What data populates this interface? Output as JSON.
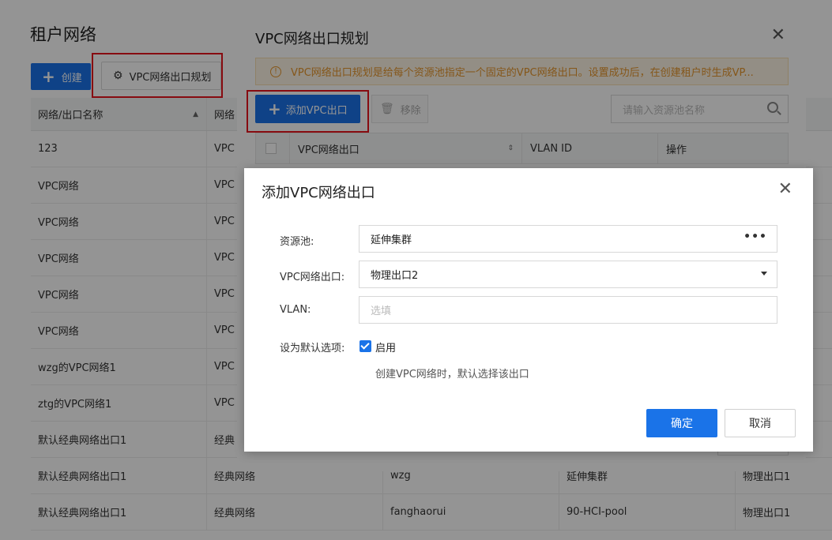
{
  "page": {
    "title": "租户网络",
    "create_label": "创建",
    "plan_label": "VPC网络出口规划",
    "table": {
      "headers": [
        "网络/出口名称",
        "网络",
        "",
        "",
        ""
      ],
      "rows": [
        [
          "123",
          "VPC",
          "",
          "",
          ""
        ],
        [
          "VPC网络",
          "VPC",
          "",
          "",
          ""
        ],
        [
          "VPC网络",
          "VPC",
          "",
          "",
          ""
        ],
        [
          "VPC网络",
          "VPC",
          "",
          "",
          ""
        ],
        [
          "VPC网络",
          "VPC",
          "",
          "",
          ""
        ],
        [
          "VPC网络",
          "VPC",
          "",
          "",
          ""
        ],
        [
          "wzg的VPC网络1",
          "VPC",
          "",
          "",
          ""
        ],
        [
          "ztg的VPC网络1",
          "VPC",
          "",
          "",
          ""
        ],
        [
          "默认经典网络出口1",
          "经典",
          "",
          "",
          ""
        ],
        [
          "默认经典网络出口1",
          "经典网络",
          "wzg",
          "延伸集群",
          "物理出口1"
        ],
        [
          "默认经典网络出口1",
          "经典网络",
          "fanghaorui",
          "90-HCI-pool",
          "物理出口1"
        ]
      ]
    }
  },
  "modal1": {
    "title": "VPC网络出口规划",
    "close": "✕",
    "alert": "VPC网络出口规划是给每个资源池指定一个固定的VPC网络出口。设置成功后，在创建租户时生成VP...",
    "add_label": "添加VPC出口",
    "remove_label": "移除",
    "search_placeholder": "请输入资源池名称",
    "table_headers": [
      "VPC网络出口",
      "VLAN ID",
      "操作"
    ]
  },
  "modal2": {
    "title": "添加VPC网络出口",
    "close": "✕",
    "fields": {
      "pool_label": "资源池:",
      "pool_value": "延伸集群",
      "exit_label": "VPC网络出口:",
      "exit_value": "物理出口2",
      "vlan_label": "VLAN:",
      "vlan_placeholder": "选填",
      "default_label": "设为默认选项:",
      "default_checkbox_label": "启用",
      "default_checked": true
    },
    "hint": "创建VPC网络时，默认选择该出口",
    "ok_label": "确定",
    "cancel_label": "取消"
  },
  "colors": {
    "primary": "#1a73e8",
    "highlight": "#e8141c",
    "warning": "#e6962d"
  }
}
